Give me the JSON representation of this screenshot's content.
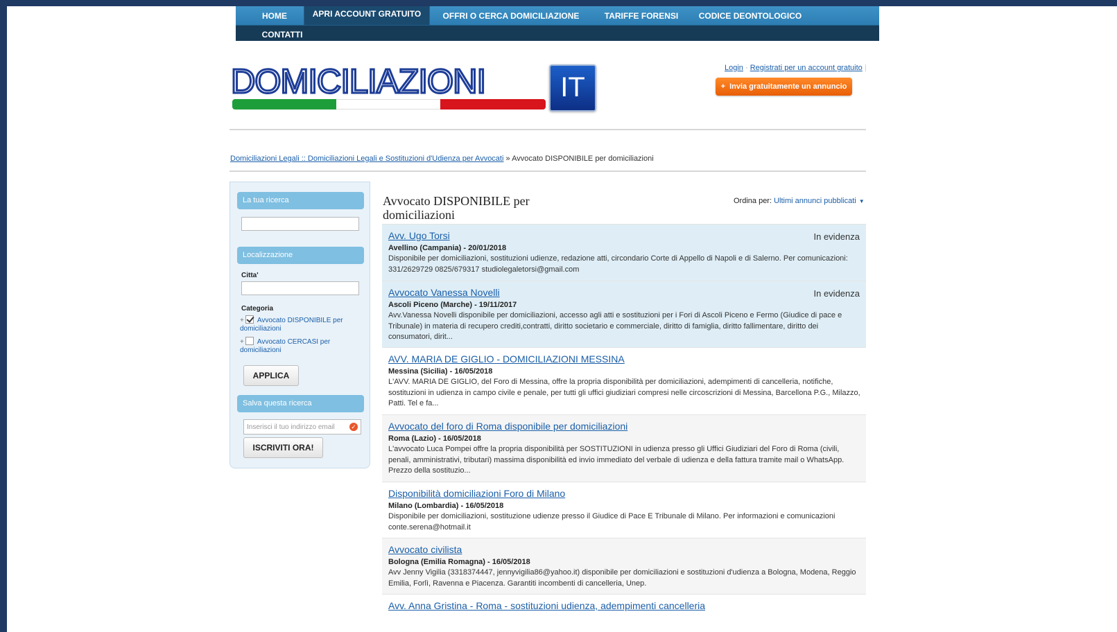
{
  "nav": {
    "items": [
      "HOME",
      "APRI ACCOUNT GRATUITO",
      "OFFRI O CERCA DOMICILIAZIONE",
      "TARIFFE FORENSI",
      "CODICE DEONTOLOGICO",
      "CONTATTI"
    ]
  },
  "logo": {
    "text": "DOMICILIAZIONI",
    "suffix": "IT",
    "colors": [
      "#1e9e3a",
      "#ffffff",
      "#d8141c"
    ]
  },
  "header": {
    "login": "Login",
    "register": "Registrati per un account gratuito",
    "post_ad": "Invia gratuitamente un annuncio"
  },
  "breadcrumb": {
    "link": "Domiciliazioni Legali :: Domiciliazioni Legali e Sostituzioni d'Udienza per Avvocati",
    "sep": "»",
    "current": "Avvocato DISPONIBILE per domiciliazioni"
  },
  "sidebar": {
    "search_head": "La tua ricerca",
    "location_head": "Localizzazione",
    "city_label": "Citta'",
    "category_label": "Categoria",
    "categories": [
      {
        "label": "Avvocato DISPONIBILE per domiciliazioni",
        "checked": true
      },
      {
        "label": "Avvocato CERCASI per domiciliazioni",
        "checked": false
      }
    ],
    "apply": "APPLICA",
    "save_head": "Salva questa ricerca",
    "email_placeholder": "Inserisci il tuo indirizzo email",
    "subscribe": "ISCRIVITI ORA!"
  },
  "main": {
    "title": "Avvocato DISPONIBILE per domiciliazioni",
    "sort_label": "Ordina per:",
    "sort_value": "Ultimi annunci pubblicati",
    "items": [
      {
        "title": "Avv. Ugo Torsi",
        "badge": "In evidenza",
        "loc": "Avellino (Campania) - 20/01/2018",
        "desc": "Disponibile per domiciliazioni, sostituzioni udienze, redazione atti, circondario Corte di Appello di Napoli e di Salerno. Per comunicazioni: 331/2629729 0825/679317 studiolegaletorsi@gmail.com"
      },
      {
        "title": "Avvocato Vanessa Novelli",
        "badge": "In evidenza",
        "loc": "Ascoli Piceno (Marche) - 19/11/2017",
        "desc": "Avv.Vanessa Novelli disponibile per domiciliazioni, accesso agli atti e sostituzioni per i Fori di Ascoli Piceno e Fermo (Giudice di pace e Tribunale) in materia di recupero crediti,contratti, diritto societario e commerciale, diritto di famiglia, diritto fallimentare, diritto dei consumatori, dirit..."
      },
      {
        "title": "AVV. MARIA DE GIGLIO - DOMICILIAZIONI MESSINA",
        "badge": "",
        "loc": "Messina (Sicilia) - 16/05/2018",
        "desc": "L'AVV. MARIA DE GIGLIO, del Foro di Messina, offre la propria disponibilità per domiciliazioni, adempimenti di cancelleria, notifiche, sostituzioni in udienza in campo civile e penale, per tutti gli uffici giudiziari compresi nelle circoscrizioni di Messina, Barcellona P.G., Milazzo, Patti. Tel e fa..."
      },
      {
        "title": "Avvocato del foro di Roma disponibile per domiciliazioni",
        "badge": "",
        "loc": "Roma (Lazio) - 16/05/2018",
        "desc": "L'avvocato Luca Pompei offre la propria disponibilità per SOSTITUZIONI in udienza presso gli Uffici Giudiziari del Foro di Roma (civili, penali, amministrativi, tributari) massima disponibilità ed invio immediato del verbale di udienza e della fattura tramite mail o WhatsApp. Prezzo della sostituzio..."
      },
      {
        "title": "Disponibilità domiciliazioni Foro di Milano",
        "badge": "",
        "loc": "Milano (Lombardia) - 16/05/2018",
        "desc": "Disponibile per domiciliazioni, sostituzione udienze presso il Giudice di Pace E Tribunale di Milano. Per informazioni e comunicazioni conte.serena@hotmail.it"
      },
      {
        "title": "Avvocato civilista",
        "badge": "",
        "loc": "Bologna (Emilia Romagna) - 16/05/2018",
        "desc": "Avv Jenny Vigilia (3318374447, jennyvigilia86@yahoo.it) disponibile per domiciliazioni e sostituzioni d'udienza a Bologna, Modena, Reggio Emilia, Forlì, Ravenna e Piacenza. Garantiti incombenti di cancelleria, Unep."
      },
      {
        "title": "Avv. Anna Gristina - Roma - sostituzioni udienza, adempimenti cancelleria",
        "badge": "",
        "loc": "",
        "desc": ""
      }
    ]
  }
}
